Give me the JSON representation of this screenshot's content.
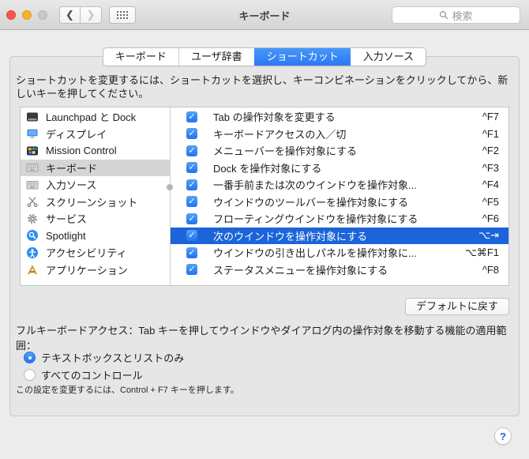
{
  "colors": {
    "accent_blue": "#2c7ef8",
    "row_selection_blue": "#1b64d9",
    "sidebar_selection_gray": "#d5d5d5",
    "traffic_red": "#f6574e",
    "traffic_yellow": "#f6b02c"
  },
  "titlebar": {
    "title": "キーボード",
    "back_glyph": "❮",
    "forward_glyph": "❯",
    "search_placeholder": "検索"
  },
  "tabs": [
    {
      "label": "キーボード",
      "selected": false
    },
    {
      "label": "ユーザ辞書",
      "selected": false
    },
    {
      "label": "ショートカット",
      "selected": true
    },
    {
      "label": "入力ソース",
      "selected": false
    }
  ],
  "instruction": "ショートカットを変更するには、ショートカットを選択し、キーコンビネーションをクリックしてから、新しいキーを押してください。",
  "sidebar": {
    "items": [
      {
        "label": "Launchpad と Dock",
        "icon": "launchpad-dock",
        "selected": false
      },
      {
        "label": "ディスプレイ",
        "icon": "display",
        "selected": false
      },
      {
        "label": "Mission Control",
        "icon": "mission-control",
        "selected": false
      },
      {
        "label": "キーボード",
        "icon": "keyboard",
        "selected": true
      },
      {
        "label": "入力ソース",
        "icon": "input-source",
        "selected": false
      },
      {
        "label": "スクリーンショット",
        "icon": "screenshot",
        "selected": false
      },
      {
        "label": "サービス",
        "icon": "services",
        "selected": false
      },
      {
        "label": "Spotlight",
        "icon": "spotlight",
        "selected": false
      },
      {
        "label": "アクセシビリティ",
        "icon": "accessibility",
        "selected": false
      },
      {
        "label": "アプリケーション",
        "icon": "applications",
        "selected": false
      }
    ]
  },
  "shortcuts": {
    "rows": [
      {
        "label": "Tab の操作対象を変更する",
        "shortcut": "^F7",
        "checked": true,
        "selected": false
      },
      {
        "label": "キーボードアクセスの入／切",
        "shortcut": "^F1",
        "checked": true,
        "selected": false
      },
      {
        "label": "メニューバーを操作対象にする",
        "shortcut": "^F2",
        "checked": true,
        "selected": false
      },
      {
        "label": "Dock を操作対象にする",
        "shortcut": "^F3",
        "checked": true,
        "selected": false
      },
      {
        "label": "一番手前または次のウインドウを操作対象...",
        "shortcut": "^F4",
        "checked": true,
        "selected": false
      },
      {
        "label": "ウインドウのツールバーを操作対象にする",
        "shortcut": "^F5",
        "checked": true,
        "selected": false
      },
      {
        "label": "フローティングウインドウを操作対象にする",
        "shortcut": "^F6",
        "checked": true,
        "selected": false
      },
      {
        "label": "次のウインドウを操作対象にする",
        "shortcut": "⌥⇥",
        "checked": true,
        "selected": true
      },
      {
        "label": "ウインドウの引き出しパネルを操作対象に...",
        "shortcut": "⌥⌘F1",
        "checked": true,
        "selected": false
      },
      {
        "label": "ステータスメニューを操作対象にする",
        "shortcut": "^F8",
        "checked": true,
        "selected": false
      }
    ],
    "check_glyph": "✓"
  },
  "restore_defaults_label": "デフォルトに戻す",
  "full_access": {
    "label": "フルキーボードアクセス：Tab キーを押してウインドウやダイアログ内の操作対象を移動する機能の適用範囲：",
    "options": [
      {
        "label": "テキストボックスとリストのみ",
        "selected": true
      },
      {
        "label": "すべてのコントロール",
        "selected": false
      }
    ],
    "note": "この設定を変更するには、Control + F7 キーを押します。"
  },
  "help_label": "?"
}
